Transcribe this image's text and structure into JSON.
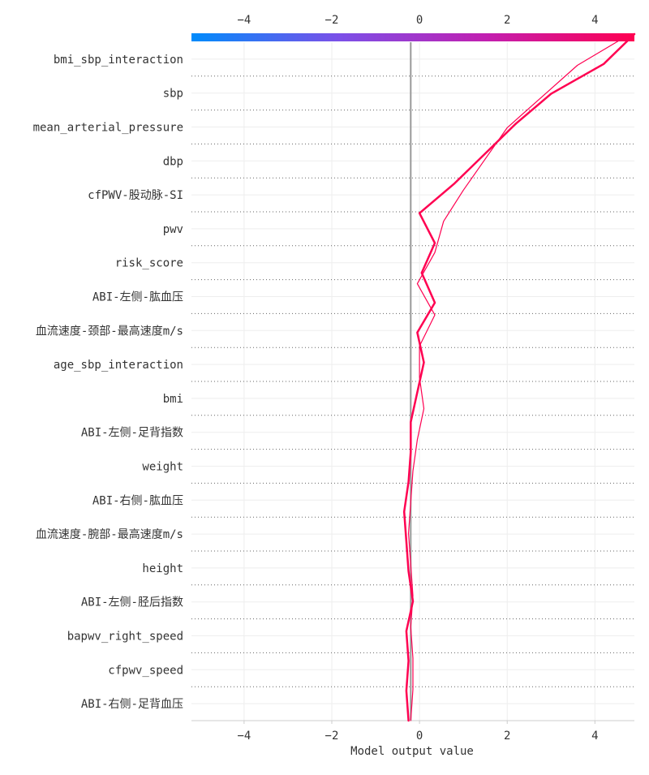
{
  "chart_data": {
    "type": "line",
    "subtype": "shap-decision-plot",
    "title": "",
    "xlabel": "Model output value",
    "ylabel": "",
    "xlim": [
      -5.2,
      4.9
    ],
    "xticks": [
      -4,
      -2,
      0,
      2,
      4
    ],
    "xtick_labels": [
      "−4",
      "−2",
      "0",
      "2",
      "4"
    ],
    "base_value": -0.2,
    "grid": true,
    "legend": "none",
    "colorbar": {
      "position": "top",
      "range": [
        -5.2,
        4.9
      ],
      "colors": [
        "#008bfb",
        "#7b50e8",
        "#c21fb0",
        "#ff0051"
      ]
    },
    "features": [
      "bmi_sbp_interaction",
      "sbp",
      "mean_arterial_pressure",
      "dbp",
      "cfPWV-股动脉-SI",
      "pwv",
      "risk_score",
      "ABI-左侧-肱血压",
      "血流速度-颈部-最高速度m/s",
      "age_sbp_interaction",
      "bmi",
      "ABI-左侧-足背指数",
      "weight",
      "ABI-右侧-肱血压",
      "血流速度-腕部-最高速度m/s",
      "height",
      "ABI-左侧-胫后指数",
      "bapwv_right_speed",
      "cfpwv_speed",
      "ABI-右侧-足背血压"
    ],
    "series": [
      {
        "color": "#ff0051",
        "stroke_width": 2.5,
        "values": [
          -0.25,
          -0.3,
          -0.25,
          -0.3,
          -0.15,
          -0.25,
          -0.3,
          -0.35,
          -0.25,
          -0.2,
          -0.2,
          -0.05,
          0.1,
          -0.05,
          0.35,
          0.05,
          0.35,
          0.0,
          0.8,
          1.5,
          2.2,
          3.0,
          4.2,
          4.9
        ]
      },
      {
        "color": "#ff0051",
        "stroke_width": 1.2,
        "values": [
          -0.2,
          -0.15,
          -0.15,
          -0.2,
          -0.15,
          -0.2,
          -0.25,
          -0.2,
          -0.15,
          -0.05,
          0.1,
          0.0,
          0.0,
          0.35,
          -0.05,
          0.35,
          0.55,
          1.0,
          1.5,
          2.0,
          2.8,
          3.6,
          4.8
        ]
      }
    ]
  }
}
